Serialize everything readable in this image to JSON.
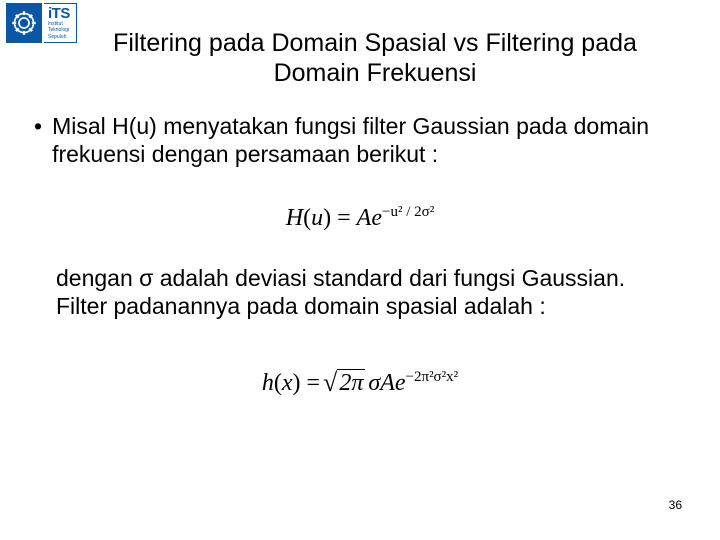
{
  "logo": {
    "its": "iTS",
    "sub1": "Institut",
    "sub2": "Teknologi",
    "sub3": "Sepuluh"
  },
  "title": "Filtering pada Domain Spasial vs Filtering pada Domain Frekuensi",
  "bullet": "•",
  "para1": "Misal H(u) menyatakan fungsi filter Gaussian pada domain frekuensi dengan persamaan berikut :",
  "formula1": {
    "lhs": "H",
    "lparen": "(",
    "arg": "u",
    "rparen": ")",
    "eq": " = ",
    "A": "A",
    "e": "e",
    "exp": "−u² / 2σ²"
  },
  "para2": "dengan σ adalah deviasi standard dari fungsi Gaussian. Filter padanannya pada domain spasial adalah :",
  "formula2": {
    "lhs": "h",
    "lparen": "(",
    "arg": "x",
    "rparen": ")",
    "eq": " = ",
    "sqrt_in": "2π",
    "sigma": "σ",
    "A": "A",
    "e": "e",
    "exp": "−2π²σ²x²"
  },
  "page_number": "36"
}
